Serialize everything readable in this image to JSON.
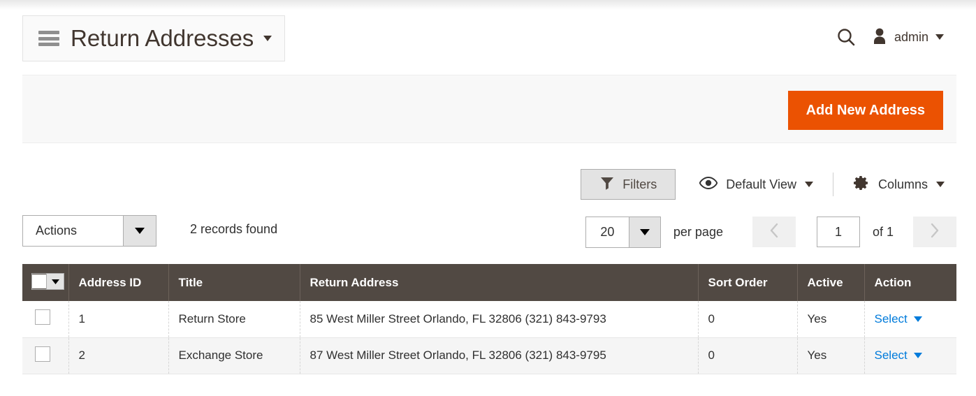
{
  "header": {
    "menu_icon": "hamburger-icon",
    "title": "Return Addresses",
    "title_caret": "▾",
    "search_icon": "search-icon",
    "user_icon": "user-icon",
    "user_name": "admin",
    "user_caret": "▾"
  },
  "action_bar": {
    "add_button_label": "Add New Address",
    "add_button_color": "#eb5202"
  },
  "toolbar": {
    "filters_label": "Filters",
    "filters_icon": "funnel-icon",
    "view_label": "Default View",
    "view_icon": "eye-icon",
    "columns_label": "Columns",
    "columns_icon": "gear-icon"
  },
  "controls": {
    "actions_label": "Actions",
    "records_found": "2 records found",
    "per_page_value": "20",
    "per_page_label": "per page",
    "prev_icon": "chevron-left-icon",
    "next_icon": "chevron-right-icon",
    "page_value": "1",
    "page_total": "of 1"
  },
  "grid": {
    "columns": [
      "Address ID",
      "Title",
      "Return Address",
      "Sort Order",
      "Active",
      "Action"
    ],
    "rows": [
      {
        "id": "1",
        "title": "Return Store",
        "address": "85 West Miller Street Orlando, FL 32806 (321) 843-9793",
        "sort_order": "0",
        "active": "Yes",
        "action": "Select",
        "action_caret": "▾"
      },
      {
        "id": "2",
        "title": "Exchange Store",
        "address": "87 West Miller Street Orlando, FL 32806 (321) 843-9795",
        "sort_order": "0",
        "active": "Yes",
        "action": "Select",
        "action_caret": "▾"
      }
    ]
  },
  "colors": {
    "accent_orange": "#eb5202",
    "header_brown": "#514943",
    "link_blue": "#007bdb"
  }
}
